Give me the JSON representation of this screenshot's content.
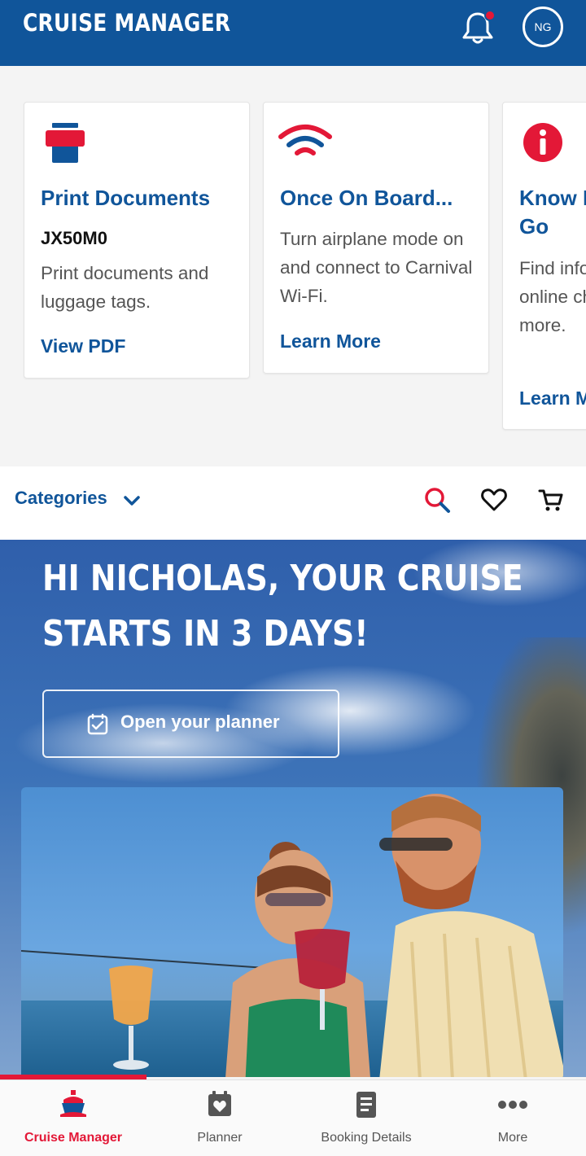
{
  "header": {
    "title": "CRUISE MANAGER",
    "avatar_initials": "NG"
  },
  "cards": [
    {
      "title": "Print Documents",
      "code": "JX50M0",
      "description": "Print documents and luggage tags.",
      "link": "View PDF",
      "icon": "printer-icon"
    },
    {
      "title": "Once On Board...",
      "description": "Turn airplane mode on and connect to Carnival Wi-Fi.",
      "link": "Learn More",
      "icon": "wifi-icon"
    },
    {
      "title": "Know Before You Go",
      "description": "Find info on travel docs, online check-in and more.",
      "link": "Learn More",
      "icon": "info-icon"
    }
  ],
  "category_bar": {
    "label": "Categories"
  },
  "hero": {
    "title_line1": "HI NICHOLAS, YOUR CRUISE",
    "title_line2": "STARTS IN 3 DAYS!",
    "planner_button": "Open your planner"
  },
  "bottom_nav": [
    {
      "label": "Cruise Manager",
      "icon": "ship-icon",
      "active": true
    },
    {
      "label": "Planner",
      "icon": "calendar-heart-icon",
      "active": false
    },
    {
      "label": "Booking Details",
      "icon": "document-icon",
      "active": false
    },
    {
      "label": "More",
      "icon": "more-dots-icon",
      "active": false
    }
  ],
  "colors": {
    "brand_blue": "#10559a",
    "accent_red": "#e31837"
  }
}
